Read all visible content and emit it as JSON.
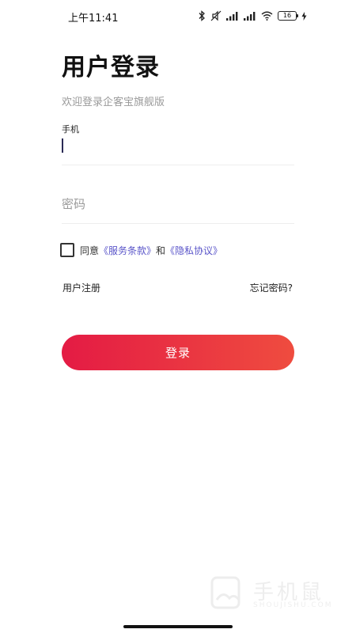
{
  "status_bar": {
    "time": "上午11:41",
    "battery": "16"
  },
  "login": {
    "title": "用户登录",
    "subtitle": "欢迎登录企客宝旗舰版",
    "phone_label": "手机",
    "phone_value": "",
    "password_placeholder": "密码",
    "agree_prefix": "同意",
    "terms_link": "《服务条款》",
    "agree_and": "和",
    "privacy_link": "《隐私协议》",
    "register": "用户注册",
    "forgot_password": "忘记密码?",
    "login_button": "登录"
  },
  "watermark": {
    "text": "手机鼠",
    "sub": "SHOUJISHU.COM"
  },
  "colors": {
    "accent_start": "#e41b44",
    "accent_end": "#ef4c3f",
    "link": "#5a55c9"
  }
}
